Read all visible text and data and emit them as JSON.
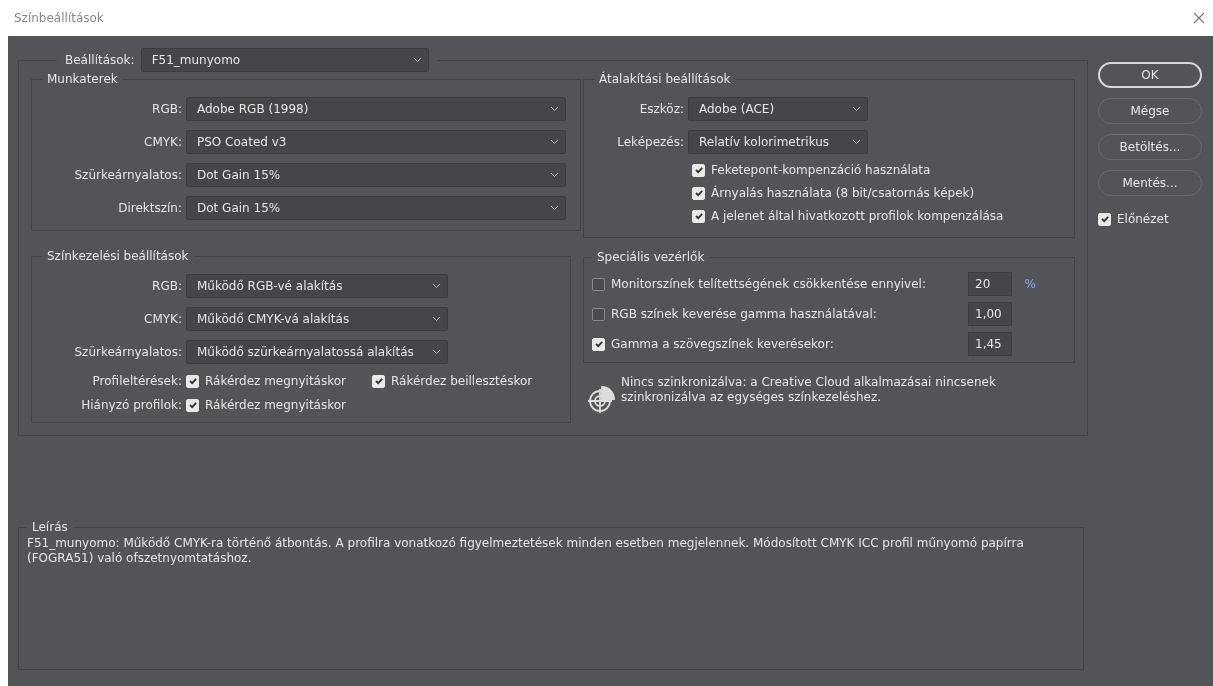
{
  "window": {
    "title": "Színbeállítások"
  },
  "settings": {
    "label": "Beállítások:",
    "value": "F51_munyomo"
  },
  "working_spaces": {
    "title": "Munkaterek",
    "rows": [
      {
        "label": "RGB:",
        "value": "Adobe RGB (1998)"
      },
      {
        "label": "CMYK:",
        "value": "PSO Coated v3"
      },
      {
        "label": "Szürkeárnyalatos:",
        "value": "Dot Gain 15%"
      },
      {
        "label": "Direktszín:",
        "value": "Dot Gain 15%"
      }
    ]
  },
  "color_management": {
    "title": "Színkezelési beállítások",
    "rows": [
      {
        "label": "RGB:",
        "value": "Működő RGB-vé alakítás"
      },
      {
        "label": "CMYK:",
        "value": "Működő CMYK-vá alakítás"
      },
      {
        "label": "Szürkeárnyalatos:",
        "value": "Működő szürkeárnyalatossá alakítás"
      }
    ],
    "check_rows": [
      {
        "label": "Profileltérések:",
        "options": [
          {
            "label": "Rákérdez megnyitáskor",
            "checked": true
          },
          {
            "label": "Rákérdez beillesztéskor",
            "checked": true
          }
        ]
      },
      {
        "label": "Hiányzó profilok:",
        "options": [
          {
            "label": "Rákérdez megnyitáskor",
            "checked": true
          }
        ]
      }
    ]
  },
  "conversion": {
    "title": "Átalakítási beállítások",
    "rows": [
      {
        "label": "Eszköz:",
        "value": "Adobe (ACE)"
      },
      {
        "label": "Leképezés:",
        "value": "Relatív kolorimetrikus"
      }
    ],
    "options": [
      {
        "label": "Feketepont-kompenzáció használata",
        "checked": true
      },
      {
        "label": "Árnyalás használata (8 bit/csatornás képek)",
        "checked": true
      },
      {
        "label": "A jelenet által hivatkozott profilok kompenzálása",
        "checked": true
      }
    ]
  },
  "advanced": {
    "title": "Speciális vezérlők",
    "rows": [
      {
        "label": "Monitorszínek telítettségének csökkentése ennyivel:",
        "checked": false,
        "value": "20",
        "unit": "%"
      },
      {
        "label": "RGB színek keverése gamma használatával:",
        "checked": false,
        "value": "1,00"
      },
      {
        "label": "Gamma a szövegszínek keverésekor:",
        "checked": true,
        "value": "1,45"
      }
    ]
  },
  "sync_note": "Nincs szinkronizálva: a Creative Cloud alkalmazásai nincsenek szinkronizálva az egységes színkezeléshez.",
  "buttons": [
    {
      "label": "OK",
      "primary": true
    },
    {
      "label": "Mégse",
      "primary": false
    },
    {
      "label": "Betöltés...",
      "primary": false
    },
    {
      "label": "Mentés...",
      "primary": false
    }
  ],
  "preview": {
    "label": "Előnézet",
    "checked": true
  },
  "description": {
    "title": "Leírás",
    "text": "F51_munyomo:  Működő CMYK-ra történő átbontás. A profilra vonatkozó figyelmeztetések minden esetben megjelennek. Módosított CMYK ICC profil műnyomó papírra (FOGRA51) való ofszetnyomtatáshoz."
  }
}
